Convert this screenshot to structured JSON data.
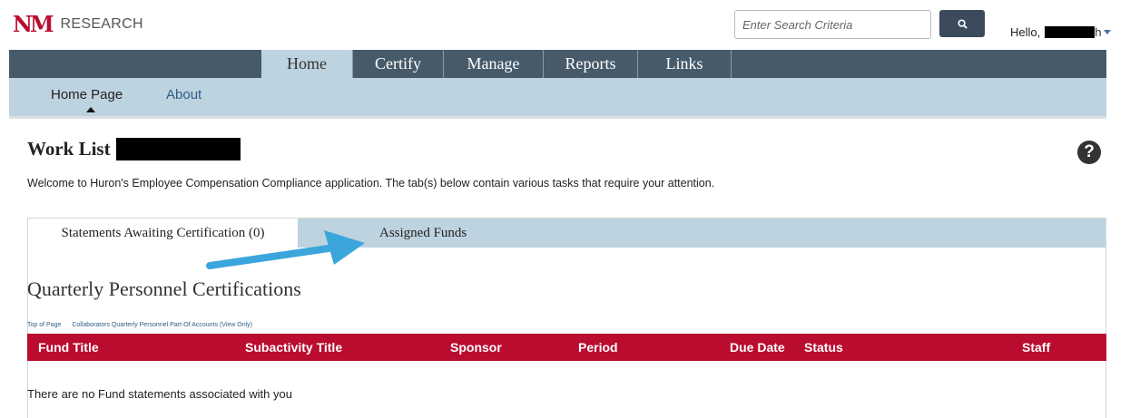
{
  "header": {
    "logo_mark": "NM",
    "logo_text": "RESEARCH",
    "search_placeholder": "Enter Search Criteria",
    "greeting": "Hello,",
    "greeting_tail": "h"
  },
  "main_nav": {
    "tabs": [
      {
        "label": "Home",
        "active": true
      },
      {
        "label": "Certify",
        "active": false
      },
      {
        "label": "Manage",
        "active": false
      },
      {
        "label": "Reports",
        "active": false
      },
      {
        "label": "Links",
        "active": false
      }
    ]
  },
  "sub_nav": {
    "items": [
      {
        "label": "Home Page",
        "active": true
      },
      {
        "label": "About",
        "active": false
      }
    ]
  },
  "page": {
    "title": "Work List",
    "welcome": "Welcome to Huron's Employee Compensation Compliance application. The tab(s) below contain various tasks that require your attention."
  },
  "worklist_tabs": [
    {
      "label": "Statements Awaiting Certification (0)",
      "active": true
    },
    {
      "label": "Assigned Funds",
      "active": false
    }
  ],
  "section": {
    "title": "Quarterly Personnel Certifications",
    "links": [
      "Top of Page",
      "Collaborators Quarterly Personnel Part-Of Accounts (View Only)"
    ]
  },
  "table": {
    "columns": [
      "Fund Title",
      "Subactivity Title",
      "Sponsor",
      "Period",
      "Due Date",
      "Status",
      "Staff"
    ],
    "empty_message": "There are no Fund statements associated with you"
  },
  "colors": {
    "brand_red": "#ba0c2f",
    "nav_dark": "#465a6a",
    "nav_light": "#bdd3df",
    "annotation_arrow": "#3aa6dc"
  }
}
